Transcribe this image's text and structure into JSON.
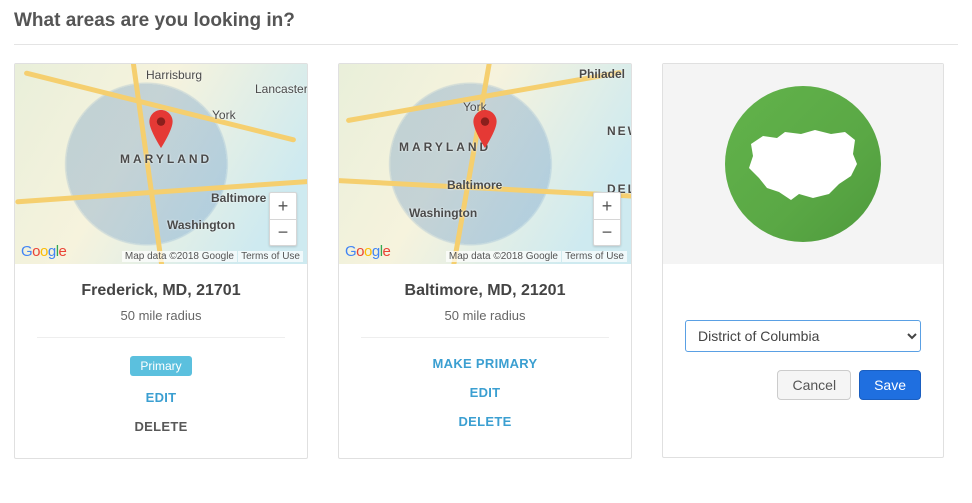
{
  "page": {
    "title": "What areas are you looking in?"
  },
  "map_controls": {
    "zoom_in": "+",
    "zoom_out": "−",
    "google": "Google",
    "attribution": "Map data ©2018 Google",
    "terms": "Terms of Use"
  },
  "cards": [
    {
      "location": "Frederick, MD, 21701",
      "radius": "50 mile radius",
      "primary_badge": "Primary",
      "edit": "EDIT",
      "delete": "DELETE",
      "cities": {
        "main": "MARYLAND",
        "balt": "Baltimore",
        "wash": "Washington",
        "harr": "Harrisburg",
        "lanc": "Lancaster",
        "york": "York"
      }
    },
    {
      "location": "Baltimore, MD, 21201",
      "radius": "50 mile radius",
      "make_primary": "MAKE PRIMARY",
      "edit": "EDIT",
      "delete": "DELETE",
      "cities": {
        "main": "MARYLAND",
        "balt": "Baltimore",
        "wash": "Washington",
        "phil": "Philadel",
        "york": "York",
        "new": "NEW",
        "del": "DEL"
      }
    }
  ],
  "form": {
    "selected_state": "District of Columbia",
    "cancel": "Cancel",
    "save": "Save"
  }
}
